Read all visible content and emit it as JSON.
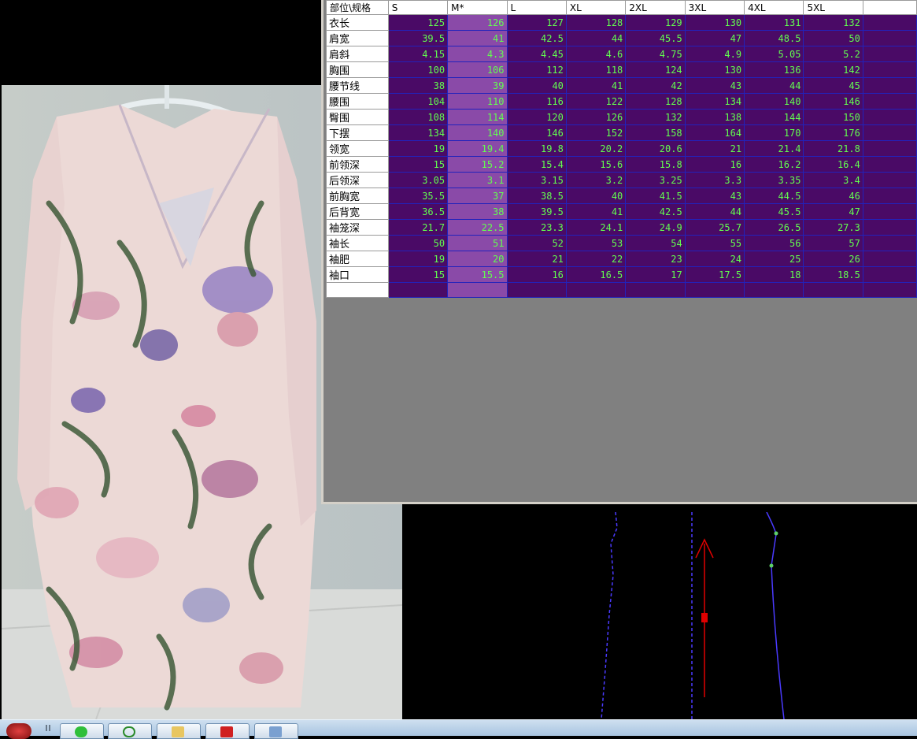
{
  "size_table": {
    "corner_header": "部位\\规格",
    "sizes": [
      "S",
      "M*",
      "L",
      "XL",
      "2XL",
      "3XL",
      "4XL",
      "5XL"
    ],
    "base_size_index": 1,
    "rows": [
      {
        "part": "衣长",
        "values": [
          "125",
          "126",
          "127",
          "128",
          "129",
          "130",
          "131",
          "132"
        ]
      },
      {
        "part": "肩宽",
        "values": [
          "39.5",
          "41",
          "42.5",
          "44",
          "45.5",
          "47",
          "48.5",
          "50"
        ]
      },
      {
        "part": "肩斜",
        "values": [
          "4.15",
          "4.3",
          "4.45",
          "4.6",
          "4.75",
          "4.9",
          "5.05",
          "5.2"
        ]
      },
      {
        "part": "胸围",
        "values": [
          "100",
          "106",
          "112",
          "118",
          "124",
          "130",
          "136",
          "142"
        ]
      },
      {
        "part": "腰节线",
        "values": [
          "38",
          "39",
          "40",
          "41",
          "42",
          "43",
          "44",
          "45"
        ]
      },
      {
        "part": "腰围",
        "values": [
          "104",
          "110",
          "116",
          "122",
          "128",
          "134",
          "140",
          "146"
        ]
      },
      {
        "part": "臀围",
        "values": [
          "108",
          "114",
          "120",
          "126",
          "132",
          "138",
          "144",
          "150"
        ]
      },
      {
        "part": "下摆",
        "values": [
          "134",
          "140",
          "146",
          "152",
          "158",
          "164",
          "170",
          "176"
        ]
      },
      {
        "part": "领宽",
        "values": [
          "19",
          "19.4",
          "19.8",
          "20.2",
          "20.6",
          "21",
          "21.4",
          "21.8"
        ]
      },
      {
        "part": "前领深",
        "values": [
          "15",
          "15.2",
          "15.4",
          "15.6",
          "15.8",
          "16",
          "16.2",
          "16.4"
        ]
      },
      {
        "part": "后领深",
        "values": [
          "3.05",
          "3.1",
          "3.15",
          "3.2",
          "3.25",
          "3.3",
          "3.35",
          "3.4"
        ]
      },
      {
        "part": "前胸宽",
        "values": [
          "35.5",
          "37",
          "38.5",
          "40",
          "41.5",
          "43",
          "44.5",
          "46"
        ]
      },
      {
        "part": "后背宽",
        "values": [
          "36.5",
          "38",
          "39.5",
          "41",
          "42.5",
          "44",
          "45.5",
          "47"
        ]
      },
      {
        "part": "袖笼深",
        "values": [
          "21.7",
          "22.5",
          "23.3",
          "24.1",
          "24.9",
          "25.7",
          "26.5",
          "27.3"
        ]
      },
      {
        "part": "袖长",
        "values": [
          "50",
          "51",
          "52",
          "53",
          "54",
          "55",
          "56",
          "57"
        ]
      },
      {
        "part": "袖肥",
        "values": [
          "19",
          "20",
          "21",
          "22",
          "23",
          "24",
          "25",
          "26"
        ]
      },
      {
        "part": "袖口",
        "values": [
          "15",
          "15.5",
          "16",
          "16.5",
          "17",
          "17.5",
          "18",
          "18.5"
        ]
      },
      {
        "part": "",
        "values": [
          "",
          "",
          "",
          "",
          "",
          "",
          "",
          ""
        ]
      }
    ]
  },
  "colors": {
    "cell_bg": "#4a0a66",
    "base_col_bg": "#8a4aa8",
    "value_text": "#62ff4f",
    "grid_line": "#2222bb",
    "panel_gray": "#808080",
    "pattern_line": "#4a3aff",
    "grain_arrow": "#e00000"
  },
  "photo": {
    "subject": "floral-print-long-sleeve-dress-on-hanger"
  },
  "taskbar": {
    "icons": [
      "start-orb-icon",
      "green-app-icon",
      "recycle-icon",
      "folder-icon",
      "red-app-icon",
      "window-icon"
    ]
  }
}
